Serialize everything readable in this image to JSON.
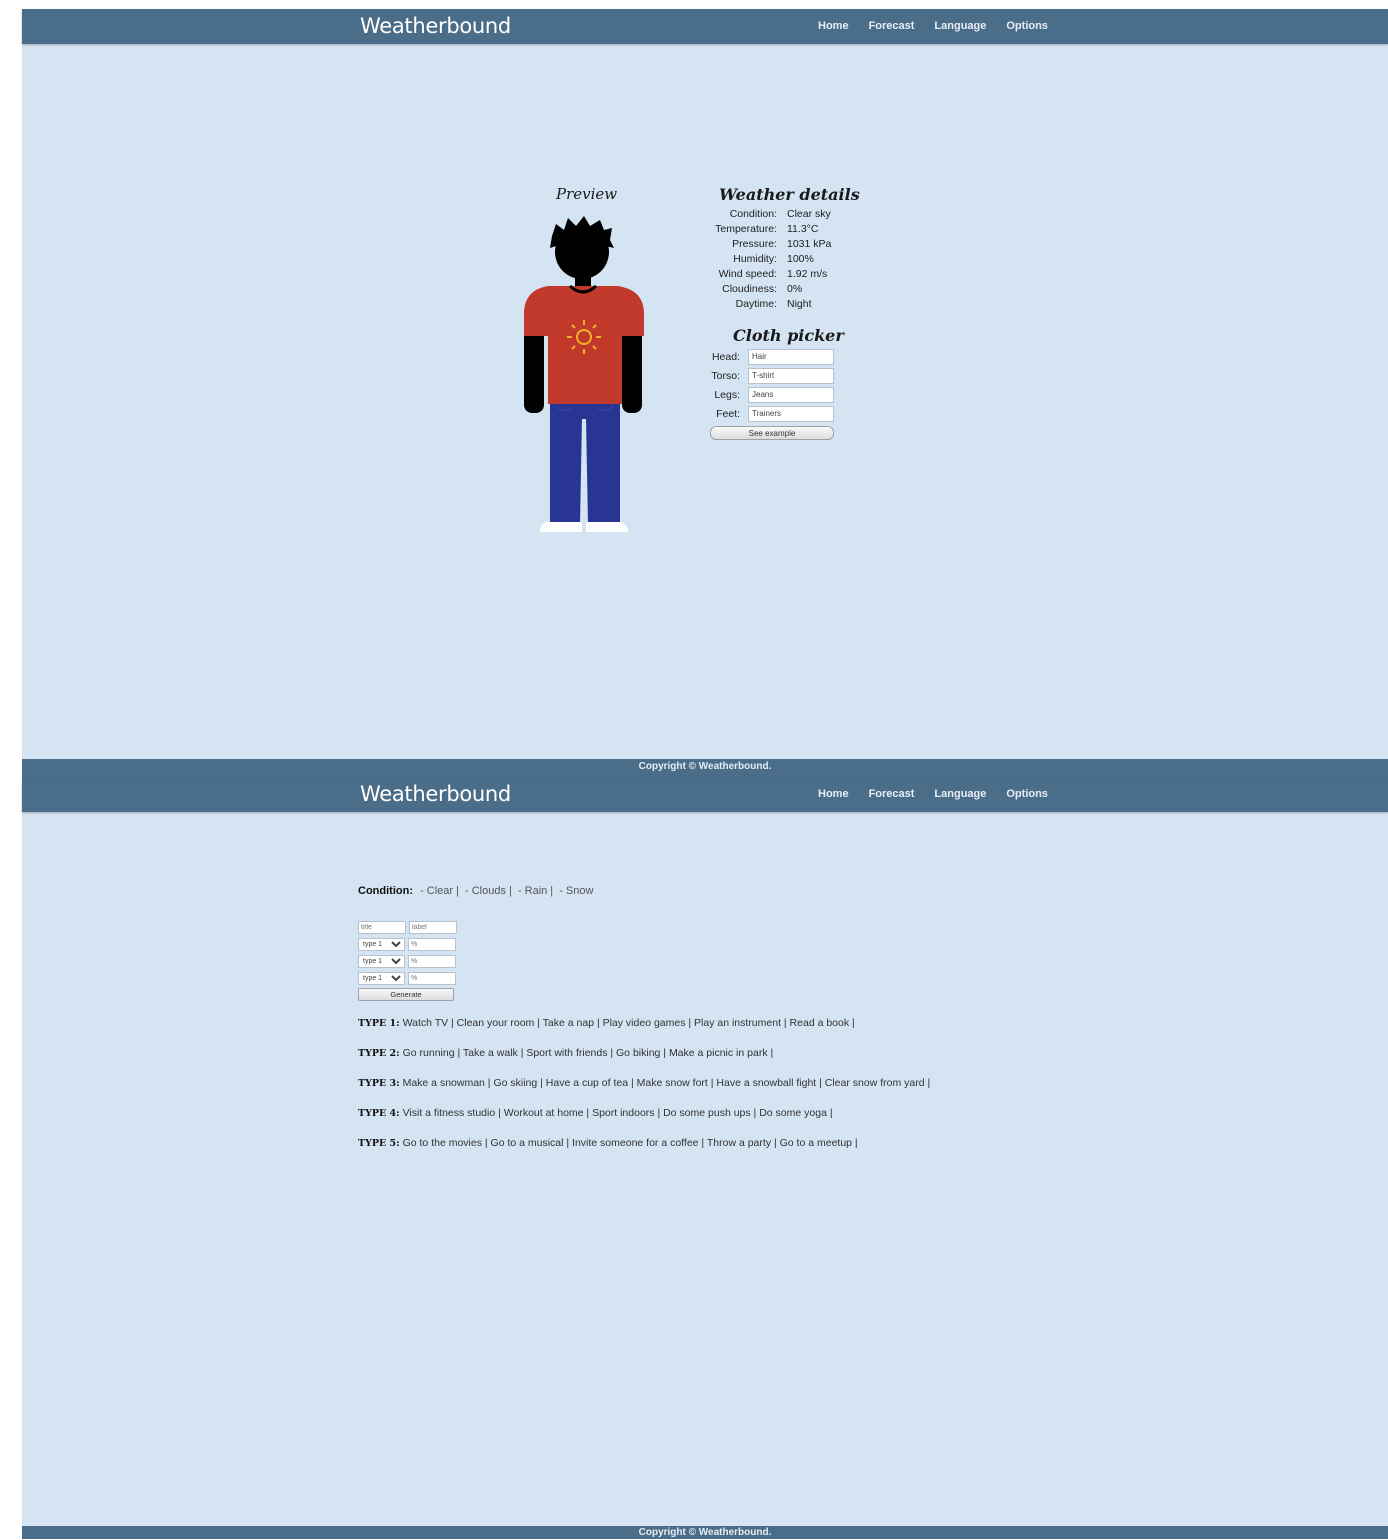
{
  "app": {
    "brand": "Weatherbound",
    "nav": [
      "Home",
      "Forecast",
      "Language",
      "Options"
    ],
    "footer": "Copyright © Weatherbound."
  },
  "preview": {
    "title": "Preview",
    "colors": {
      "hair": "#000000",
      "shirt": "#c0392b",
      "sun": "#f1b12a",
      "jeans": "#283593",
      "shoes": "#ffffff"
    }
  },
  "weather": {
    "title": "Weather details",
    "rows": [
      {
        "label": "Condition:",
        "value": "Clear sky"
      },
      {
        "label": "Temperature:",
        "value": "11.3°C"
      },
      {
        "label": "Pressure:",
        "value": "1031 kPa"
      },
      {
        "label": "Humidity:",
        "value": "100%"
      },
      {
        "label": "Wind speed:",
        "value": "1.92 m/s"
      },
      {
        "label": "Cloudiness:",
        "value": "0%"
      },
      {
        "label": "Daytime:",
        "value": "Night"
      }
    ]
  },
  "cloth_picker": {
    "title": "Cloth picker",
    "rows": [
      {
        "label": "Head:",
        "value": "Hair"
      },
      {
        "label": "Torso:",
        "value": "T-shirt"
      },
      {
        "label": "Legs:",
        "value": "Jeans"
      },
      {
        "label": "Feet:",
        "value": "Trainers"
      }
    ],
    "button": "See example"
  },
  "activities": {
    "condition_label": "Condition:",
    "conditions": [
      "Clear",
      "Clouds",
      "Rain",
      "Snow"
    ],
    "input1_placeholder": "title",
    "input2_placeholder": "label",
    "select_value": "type 1",
    "pct_placeholder": "%",
    "generate_label": "Generate",
    "types": [
      {
        "label": "TYPE 1:",
        "items": [
          "Watch TV",
          "Clean your room",
          "Take a nap",
          "Play video games",
          "Play an instrument",
          "Read a book"
        ]
      },
      {
        "label": "TYPE 2:",
        "items": [
          "Go running",
          "Take a walk",
          "Sport with friends",
          "Go biking",
          "Make a picnic in park"
        ]
      },
      {
        "label": "TYPE 3:",
        "items": [
          "Make a snowman",
          "Go skiing",
          "Have a cup of tea",
          "Make snow fort",
          "Have a snowball fight",
          "Clear snow from yard"
        ]
      },
      {
        "label": "TYPE 4:",
        "items": [
          "Visit a fitness studio",
          "Workout at home",
          "Sport indoors",
          "Do some push ups",
          "Do some yoga"
        ]
      },
      {
        "label": "TYPE 5:",
        "items": [
          "Go to the movies",
          "Go to a musical",
          "Invite someone for a coffee",
          "Throw a party",
          "Go to a meetup"
        ]
      }
    ]
  }
}
